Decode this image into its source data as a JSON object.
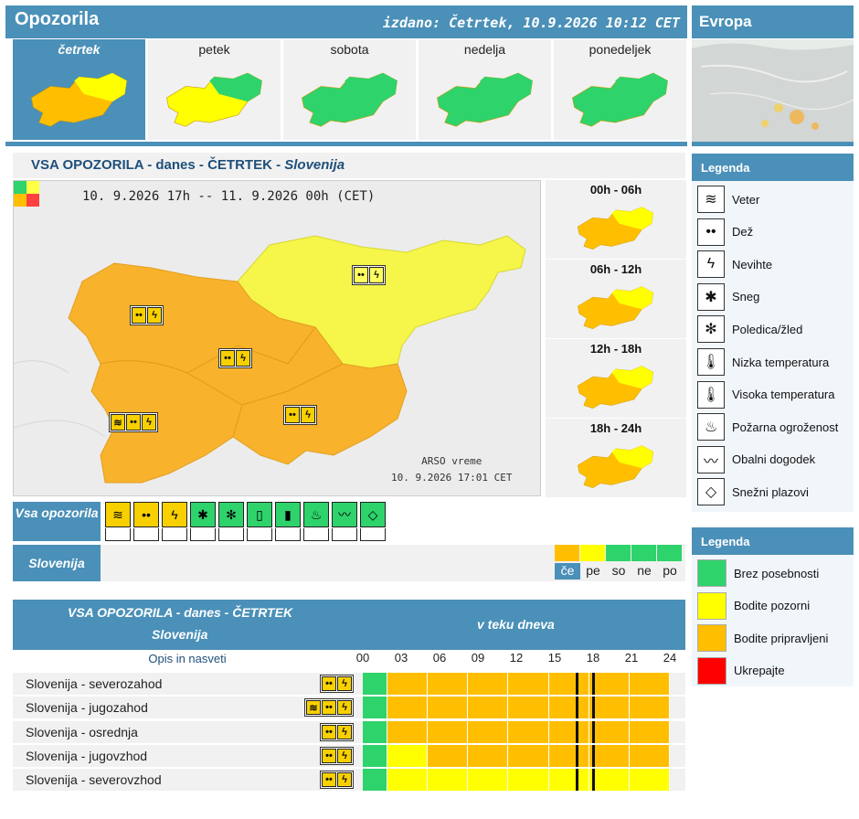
{
  "header": {
    "title": "Opozorila",
    "issued": "izdano: Četrtek, 10.9.2026 10:12 CET"
  },
  "europe": {
    "title": "Evropa"
  },
  "days": [
    {
      "label": "četrtek",
      "selected": true
    },
    {
      "label": "petek",
      "selected": false
    },
    {
      "label": "sobota",
      "selected": false
    },
    {
      "label": "nedelja",
      "selected": false
    },
    {
      "label": "ponedeljek",
      "selected": false
    }
  ],
  "section": {
    "title": "VSA OPOZORILA   -   danes   -   ČETRTEK   -   ",
    "region": "Slovenija"
  },
  "map": {
    "period": "10. 9.2026  17h  --  11. 9.2026  00h   (CET)",
    "source_line1": "ARSO vreme",
    "source_line2": "10. 9.2026  17:01 CET"
  },
  "slots": [
    "00h - 06h",
    "06h - 12h",
    "12h - 18h",
    "18h - 24h"
  ],
  "filters": {
    "all_label": "Vsa opozorila",
    "region_label": "Slovenija"
  },
  "day_tabs": [
    "če",
    "pe",
    "so",
    "ne",
    "po"
  ],
  "legend1": {
    "title": "Legenda",
    "items": [
      {
        "label": "Veter",
        "icon": "wind-icon"
      },
      {
        "label": "Dež",
        "icon": "rain-icon"
      },
      {
        "label": "Nevihte",
        "icon": "thunderstorm-icon"
      },
      {
        "label": "Sneg",
        "icon": "snow-icon"
      },
      {
        "label": "Poledica/žled",
        "icon": "ice-icon"
      },
      {
        "label": "Nizka temperatura",
        "icon": "low-temperature-icon"
      },
      {
        "label": "Visoka temperatura",
        "icon": "high-temperature-icon"
      },
      {
        "label": "Požarna ogroženost",
        "icon": "fire-danger-icon"
      },
      {
        "label": "Obalni dogodek",
        "icon": "coastal-event-icon"
      },
      {
        "label": "Snežni plazovi",
        "icon": "avalanche-icon"
      }
    ]
  },
  "legend2": {
    "title": "Legenda",
    "items": [
      {
        "label": "Brez posebnosti",
        "color": "#2ed36b"
      },
      {
        "label": "Bodite pozorni",
        "color": "#ffff00"
      },
      {
        "label": "Bodite pripravljeni",
        "color": "#ffbf00"
      },
      {
        "label": "Ukrepajte",
        "color": "#ff0000"
      }
    ]
  },
  "table": {
    "title": "VSA OPOZORILA - danes - ČETRTEK",
    "region": "Slovenija",
    "timeline_title": "v teku dneva",
    "col_label": "Opis in nasveti",
    "hours": [
      "00",
      "03",
      "06",
      "09",
      "12",
      "15",
      "18",
      "21",
      "24"
    ],
    "rows": [
      {
        "name": "Slovenija - severozahod",
        "icons": [
          "rain",
          "thunder"
        ],
        "levels": [
          "g",
          "o",
          "o",
          "o",
          "o",
          "o",
          "o",
          "o"
        ]
      },
      {
        "name": "Slovenija - jugozahod",
        "icons": [
          "wind",
          "rain",
          "thunder"
        ],
        "levels": [
          "g",
          "o",
          "o",
          "o",
          "o",
          "o",
          "o",
          "o"
        ]
      },
      {
        "name": "Slovenija - osrednja",
        "icons": [
          "rain",
          "thunder"
        ],
        "levels": [
          "g",
          "o",
          "o",
          "o",
          "o",
          "o",
          "o",
          "o"
        ]
      },
      {
        "name": "Slovenija - jugovzhod",
        "icons": [
          "rain",
          "thunder"
        ],
        "levels": [
          "g",
          "y",
          "o",
          "o",
          "o",
          "o",
          "o",
          "o"
        ]
      },
      {
        "name": "Slovenija - severovzhod",
        "icons": [
          "rain",
          "thunder"
        ],
        "levels": [
          "g",
          "y",
          "y",
          "y",
          "y",
          "y",
          "y",
          "y"
        ]
      }
    ]
  }
}
